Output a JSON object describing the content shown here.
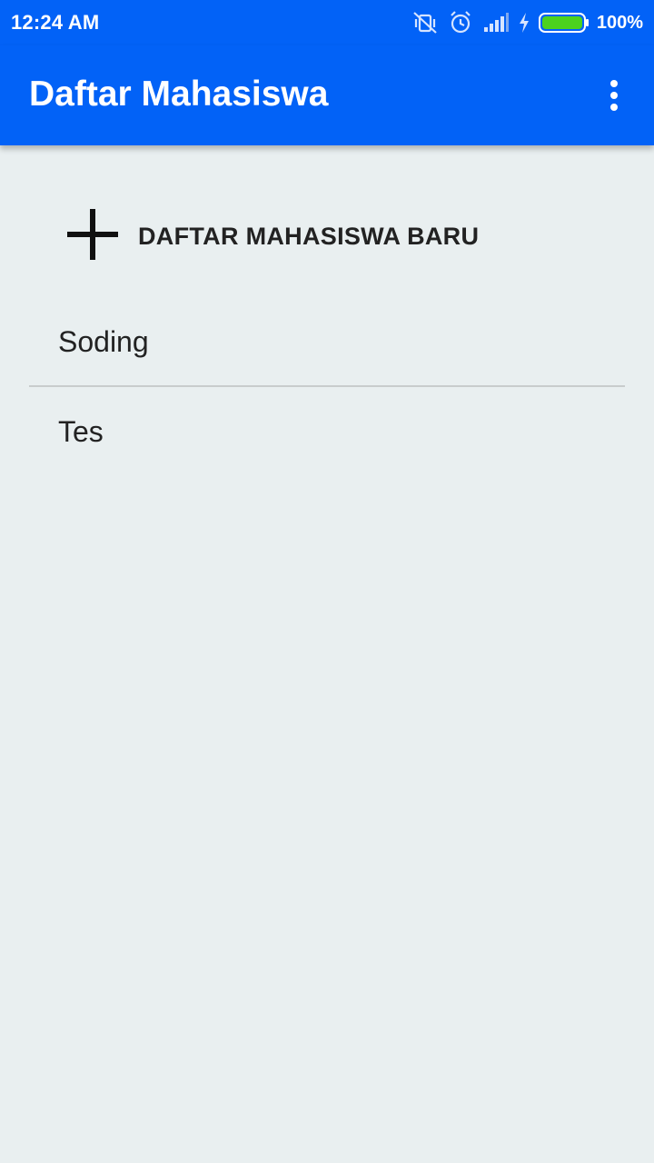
{
  "status_bar": {
    "time": "12:24 AM",
    "battery": "100%",
    "icons": [
      "vibrate-off-icon",
      "alarm-icon",
      "signal-icon",
      "charging-icon",
      "battery-icon"
    ],
    "battery_fill_fraction": 1.0
  },
  "app_bar": {
    "title": "Daftar Mahasiswa",
    "menu_icon": "more-vert-icon"
  },
  "main": {
    "add_button": {
      "icon": "plus-icon",
      "label": "DAFTAR MAHASISWA BARU"
    },
    "students": [
      {
        "name": "Soding"
      },
      {
        "name": "Tes"
      }
    ]
  },
  "colors": {
    "primary": "#0262f7",
    "background": "#e9eff0",
    "battery_green": "#4cd21e",
    "text": "#222222",
    "divider": "#c8cccc"
  }
}
